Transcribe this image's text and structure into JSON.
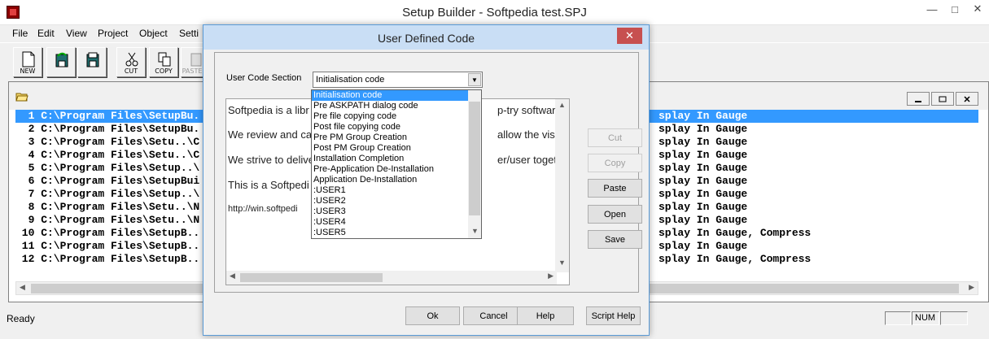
{
  "window": {
    "title": "Setup Builder - Softpedia test.SPJ",
    "controls": [
      "—",
      "□",
      "✕"
    ]
  },
  "menu": [
    "File",
    "Edit",
    "View",
    "Project",
    "Object",
    "Setti"
  ],
  "toolbar": [
    {
      "label": "NEW",
      "icon": "new-file-icon"
    },
    {
      "label": "",
      "icon": "open-file-icon"
    },
    {
      "label": "",
      "icon": "save-file-icon"
    },
    {
      "label": "CUT",
      "icon": "scissors-icon"
    },
    {
      "label": "COPY",
      "icon": "copy-icon"
    },
    {
      "label": "PASTE",
      "icon": "paste-icon"
    }
  ],
  "mdi": {
    "icon": "folder-open-icon",
    "rows": [
      {
        "left": "  1 C:\\Program Files\\SetupBu.",
        "right": "splay In Gauge",
        "selected": true
      },
      {
        "left": "  2 C:\\Program Files\\SetupBu.",
        "right": "splay In Gauge",
        "selected": false
      },
      {
        "left": "  3 C:\\Program Files\\Setu..\\C",
        "right": "splay In Gauge",
        "selected": false
      },
      {
        "left": "  4 C:\\Program Files\\Setu..\\C",
        "right": "splay In Gauge",
        "selected": false
      },
      {
        "left": "  5 C:\\Program Files\\Setup..\\",
        "right": "splay In Gauge",
        "selected": false
      },
      {
        "left": "  6 C:\\Program Files\\SetupBui",
        "right": "splay In Gauge",
        "selected": false
      },
      {
        "left": "  7 C:\\Program Files\\Setup..\\",
        "right": "splay In Gauge",
        "selected": false
      },
      {
        "left": "  8 C:\\Program Files\\Setu..\\N",
        "right": "splay In Gauge",
        "selected": false
      },
      {
        "left": "  9 C:\\Program Files\\Setu..\\N",
        "right": "splay In Gauge",
        "selected": false
      },
      {
        "left": " 10 C:\\Program Files\\SetupB..",
        "right": "splay In Gauge, Compress",
        "selected": false
      },
      {
        "left": " 11 C:\\Program Files\\SetupB..",
        "right": "splay In Gauge",
        "selected": false
      },
      {
        "left": " 12 C:\\Program Files\\SetupB..",
        "right": "splay In Gauge, Compress",
        "selected": false
      }
    ]
  },
  "status": {
    "text": "Ready",
    "num": "NUM"
  },
  "dialog": {
    "title": "User Defined Code",
    "section_label": "User Code Section",
    "section_value": "Initialisation code",
    "editor_lines": [
      "Softpedia is a libr",
      "We review and ca",
      "We strive to delive",
      "This is a Softpedi",
      "http://win.softpedi"
    ],
    "editor_lines_right": [
      "p-try software pr",
      "allow the visitor,",
      "er/user together"
    ],
    "dropdown_items": [
      "Initialisation code",
      "Pre ASKPATH dialog code",
      "Pre file copying code",
      "Post file copying code",
      "Pre PM Group Creation",
      "Post PM Group Creation",
      "Installation Completion",
      "Pre-Application De-Installation",
      "Application De-Installation",
      ":USER1",
      ":USER2",
      ":USER3",
      ":USER4",
      ":USER5"
    ],
    "side_buttons": [
      {
        "label": "Cut",
        "enabled": false
      },
      {
        "label": "Copy",
        "enabled": false
      },
      {
        "label": "Paste",
        "enabled": true
      },
      {
        "label": "Open",
        "enabled": true
      },
      {
        "label": "Save",
        "enabled": true
      }
    ],
    "bottom_buttons": [
      "Ok",
      "Cancel",
      "Help",
      "Script Help"
    ]
  }
}
